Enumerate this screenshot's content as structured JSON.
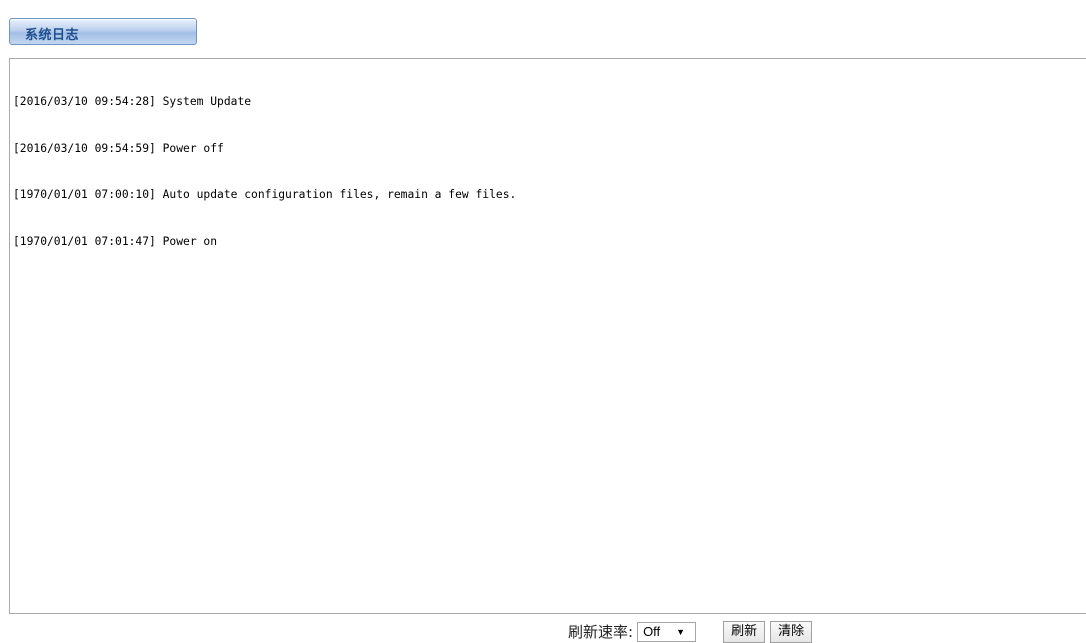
{
  "header": {
    "tab_title": "系统日志"
  },
  "log": {
    "lines": [
      "[2016/03/10 09:54:28] System Update",
      "[2016/03/10 09:54:59] Power off",
      "[1970/01/01 07:00:10] Auto update configuration files, remain a few files.",
      "[1970/01/01 07:01:47] Power on"
    ]
  },
  "controls": {
    "refresh_rate_label": "刷新速率:",
    "refresh_rate_selected": "Off",
    "refresh_rate_arrow": "▼",
    "refresh_button": "刷新",
    "clear_button": "清除"
  },
  "colors": {
    "tab_text": "#1f4f8f",
    "tab_border": "#6f95c6",
    "log_border": "#a9a9a9"
  }
}
